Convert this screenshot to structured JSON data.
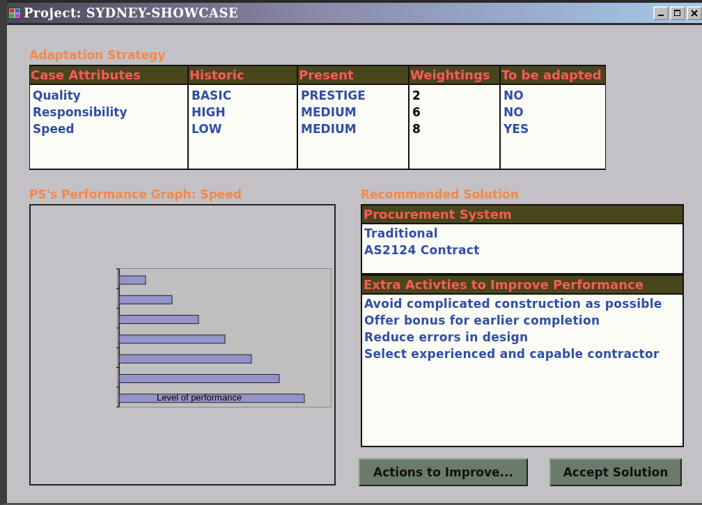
{
  "window": {
    "title": "Project: SYDNEY-SHOWCASE"
  },
  "adaptation": {
    "title": "Adaptation Strategy",
    "columns": [
      "Case Attributes",
      "Historic",
      "Present",
      "Weightings",
      "To be adapted"
    ],
    "rows": [
      {
        "cells": [
          "Quality",
          "BASIC",
          "PRESTIGE",
          "2",
          "NO"
        ]
      },
      {
        "cells": [
          "Responsibility",
          "HIGH",
          "MEDIUM",
          "6",
          "NO"
        ]
      },
      {
        "cells": [
          "Speed",
          "LOW",
          "MEDIUM",
          "8",
          "YES"
        ]
      }
    ]
  },
  "graph": {
    "title": "PS's Performance Graph: Speed",
    "bar_label": "Level of performance"
  },
  "recommended": {
    "title": "Recommended Solution",
    "procurement": {
      "heading": "Procurement System",
      "lines": [
        "Traditional",
        "AS2124 Contract"
      ]
    },
    "activities": {
      "heading": "Extra Activties to Improve Performance",
      "lines": [
        "Avoid complicated construction as possible",
        "Offer bonus for earlier completion",
        "Reduce errors in design",
        "Select experienced and capable contractor"
      ]
    }
  },
  "buttons": [
    "Actions to Improve...",
    "Accept Solution"
  ]
}
